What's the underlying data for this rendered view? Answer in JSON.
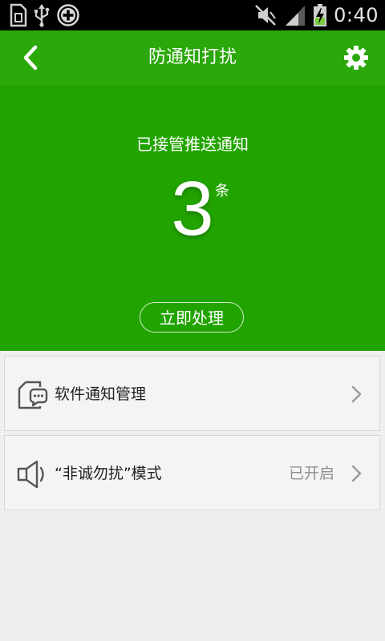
{
  "status_bar": {
    "time": "0:40",
    "icons_left": [
      "sim-card-icon",
      "usb-icon",
      "add-circle-icon"
    ],
    "icons_right": [
      "mute-icon",
      "signal-icon",
      "battery-charging-icon"
    ]
  },
  "app_bar": {
    "title": "防通知打扰",
    "back_icon": "chevron-left-icon",
    "settings_icon": "gear-icon"
  },
  "hero": {
    "caption": "已接管推送通知",
    "count": "3",
    "count_unit": "条",
    "action_label": "立即处理"
  },
  "list": {
    "items": [
      {
        "label": "软件通知管理",
        "status": "",
        "icon": "chat-bubble-icon"
      },
      {
        "label": "“非诚勿扰”模式",
        "status": "已开启",
        "icon": "speaker-icon"
      }
    ]
  },
  "colors": {
    "app_bar": "#2ba80a",
    "hero": "#22a400",
    "background": "#efefef",
    "card": "#f4f4f4"
  }
}
